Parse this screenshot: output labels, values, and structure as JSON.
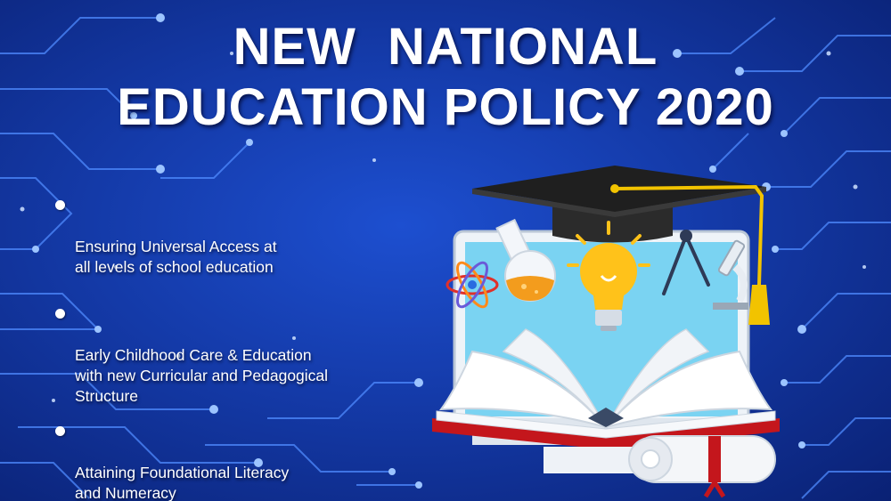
{
  "title": {
    "line1": "NEW  NATIONAL",
    "line2": "EDUCATION POLICY 2020"
  },
  "bullets": [
    {
      "text": "Ensuring Universal Access at\nall levels of school education"
    },
    {
      "text": "Early Childhood Care & Education\nwith  new Curricular and Pedagogical\nStructure"
    },
    {
      "text": "Attaining Foundational Literacy\nand Numeracy"
    }
  ],
  "icons": [
    "graduation-cap-icon",
    "atom-icon",
    "flask-icon",
    "light-bulb-icon",
    "compass-icon",
    "microscope-icon",
    "open-book-icon",
    "diploma-scroll-icon",
    "laptop-icon"
  ],
  "colors": {
    "background": "#143aa8",
    "circuit": "#4f8bff",
    "title": "#ffffff",
    "bulb": "#ffc21a",
    "ribbon": "#c4161c",
    "tassel": "#f2c300"
  }
}
